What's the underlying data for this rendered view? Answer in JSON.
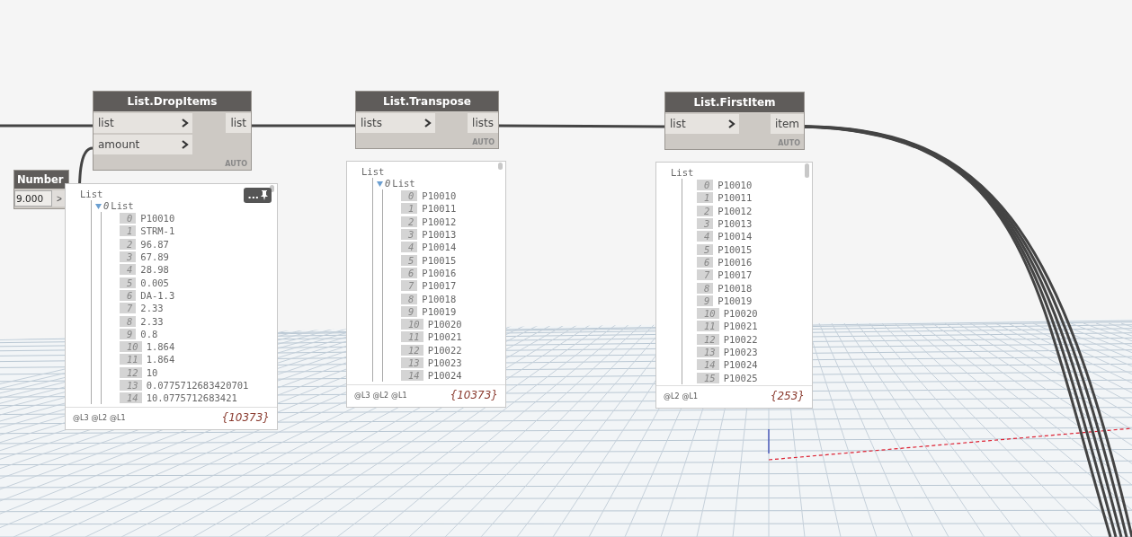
{
  "number_node": {
    "title": "Number",
    "value": "9.000",
    "button": ">"
  },
  "nodes": [
    {
      "title": "List.DropItems",
      "inputs": [
        "list",
        "amount"
      ],
      "outputs": [
        "list"
      ],
      "lacing": "AUTO",
      "preview": {
        "pin_button": "...",
        "title": "List",
        "groups": [
          {
            "index": "0",
            "label": "List",
            "expanded": true,
            "items": [
              {
                "index": "0",
                "value": "P10010"
              },
              {
                "index": "1",
                "value": "STRM-1"
              },
              {
                "index": "2",
                "value": "96.87"
              },
              {
                "index": "3",
                "value": "67.89"
              },
              {
                "index": "4",
                "value": "28.98"
              },
              {
                "index": "5",
                "value": "0.005"
              },
              {
                "index": "6",
                "value": "DA-1.3"
              },
              {
                "index": "7",
                "value": "2.33"
              },
              {
                "index": "8",
                "value": "2.33"
              },
              {
                "index": "9",
                "value": "0.8"
              },
              {
                "index": "10",
                "value": "1.864"
              },
              {
                "index": "11",
                "value": "1.864"
              },
              {
                "index": "12",
                "value": "10"
              },
              {
                "index": "13",
                "value": "0.0775712683420701"
              },
              {
                "index": "14",
                "value": "10.0775712683421"
              }
            ]
          }
        ],
        "levels": [
          "@L3",
          "@L2",
          "@L1"
        ],
        "count": "{10373}"
      }
    },
    {
      "title": "List.Transpose",
      "inputs": [
        "lists"
      ],
      "outputs": [
        "lists"
      ],
      "lacing": "AUTO",
      "preview": {
        "title": "List",
        "groups": [
          {
            "index": "0",
            "label": "List",
            "expanded": true,
            "items": [
              {
                "index": "0",
                "value": "P10010"
              },
              {
                "index": "1",
                "value": "P10011"
              },
              {
                "index": "2",
                "value": "P10012"
              },
              {
                "index": "3",
                "value": "P10013"
              },
              {
                "index": "4",
                "value": "P10014"
              },
              {
                "index": "5",
                "value": "P10015"
              },
              {
                "index": "6",
                "value": "P10016"
              },
              {
                "index": "7",
                "value": "P10017"
              },
              {
                "index": "8",
                "value": "P10018"
              },
              {
                "index": "9",
                "value": "P10019"
              },
              {
                "index": "10",
                "value": "P10020"
              },
              {
                "index": "11",
                "value": "P10021"
              },
              {
                "index": "12",
                "value": "P10022"
              },
              {
                "index": "13",
                "value": "P10023"
              },
              {
                "index": "14",
                "value": "P10024"
              }
            ]
          }
        ],
        "levels": [
          "@L3",
          "@L2",
          "@L1"
        ],
        "count": "{10373}"
      }
    },
    {
      "title": "List.FirstItem",
      "inputs": [
        "list"
      ],
      "outputs": [
        "item"
      ],
      "lacing": "AUTO",
      "preview": {
        "title": "List",
        "items": [
          {
            "index": "0",
            "value": "P10010"
          },
          {
            "index": "1",
            "value": "P10011"
          },
          {
            "index": "2",
            "value": "P10012"
          },
          {
            "index": "3",
            "value": "P10013"
          },
          {
            "index": "4",
            "value": "P10014"
          },
          {
            "index": "5",
            "value": "P10015"
          },
          {
            "index": "6",
            "value": "P10016"
          },
          {
            "index": "7",
            "value": "P10017"
          },
          {
            "index": "8",
            "value": "P10018"
          },
          {
            "index": "9",
            "value": "P10019"
          },
          {
            "index": "10",
            "value": "P10020"
          },
          {
            "index": "11",
            "value": "P10021"
          },
          {
            "index": "12",
            "value": "P10022"
          },
          {
            "index": "13",
            "value": "P10023"
          },
          {
            "index": "14",
            "value": "P10024"
          },
          {
            "index": "15",
            "value": "P10025"
          }
        ],
        "levels": [
          "@L2",
          "@L1"
        ],
        "count": "{253}"
      }
    }
  ]
}
